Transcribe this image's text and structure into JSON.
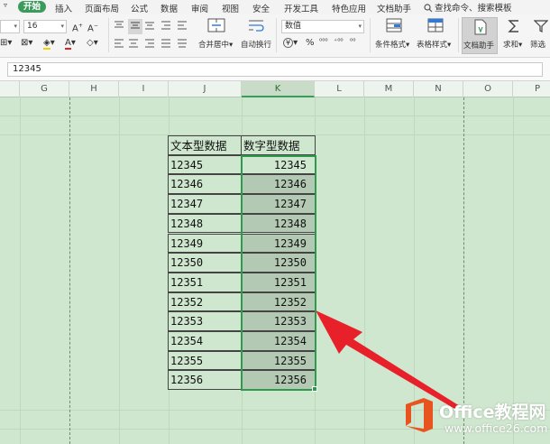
{
  "menu": {
    "items": [
      {
        "label": "开始",
        "active": true
      },
      {
        "label": "插入"
      },
      {
        "label": "页面布局"
      },
      {
        "label": "公式"
      },
      {
        "label": "数据"
      },
      {
        "label": "审阅"
      },
      {
        "label": "视图"
      },
      {
        "label": "安全"
      },
      {
        "label": "开发工具"
      },
      {
        "label": "特色应用"
      },
      {
        "label": "文档助手"
      }
    ],
    "search_label": "查找命令、搜索模板"
  },
  "ribbon": {
    "font_size": "16",
    "number_format": "数值",
    "buttons": {
      "merge_center": "合并居中",
      "auto_wrap": "自动换行",
      "conditional_format": "条件格式",
      "table_style": "表格样式",
      "doc_assistant": "文档助手",
      "sum": "求和",
      "filter": "筛选"
    },
    "percent_symbol": "%",
    "currency_symbol": "¥",
    "increase_decimal": "⁺⁰⁰",
    "decrease_decimal": "⁰⁰"
  },
  "formula_bar": {
    "value": "12345"
  },
  "columns": [
    "G",
    "H",
    "I",
    "J",
    "K",
    "L",
    "M",
    "N",
    "O",
    "P"
  ],
  "selected_column": "K",
  "table": {
    "headers": [
      "文本型数据",
      "数字型数据"
    ],
    "rows": [
      {
        "text": "12345",
        "number": "12345"
      },
      {
        "text": "12346",
        "number": "12346"
      },
      {
        "text": "12347",
        "number": "12347"
      },
      {
        "text": "12348",
        "number": "12348"
      },
      {
        "text": "12349",
        "number": "12349"
      },
      {
        "text": "12350",
        "number": "12350"
      },
      {
        "text": "12351",
        "number": "12351"
      },
      {
        "text": "12352",
        "number": "12352"
      },
      {
        "text": "12353",
        "number": "12353"
      },
      {
        "text": "12354",
        "number": "12354"
      },
      {
        "text": "12355",
        "number": "12355"
      },
      {
        "text": "12356",
        "number": "12356"
      }
    ]
  },
  "watermark": {
    "brand_latin": "Office",
    "brand_cn": "教程网",
    "site": "www.office26.com"
  },
  "colors": {
    "accent": "#3a9b5c",
    "sheet_background": "#cfe6cf",
    "selection_fill": "#b3c9b3",
    "arrow": "#e8202a",
    "logo_orange": "#e8541e"
  }
}
